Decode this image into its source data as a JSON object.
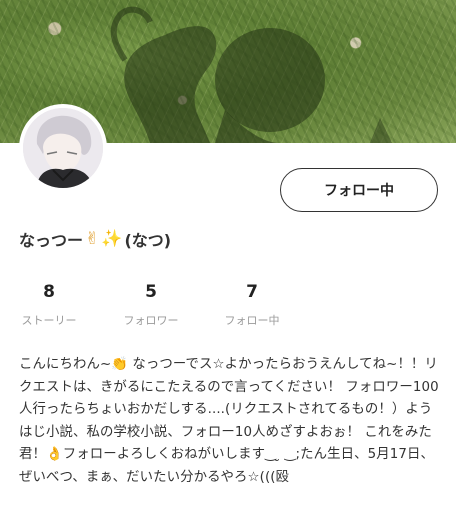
{
  "profile": {
    "name": "なっつー",
    "name_suffix": "(なつ)",
    "name_emoji_1": "✌",
    "name_emoji_2": "✨",
    "follow_button_label": "フォロー中"
  },
  "stats": [
    {
      "value": "8",
      "label": "ストーリー"
    },
    {
      "value": "5",
      "label": "フォロワー"
    },
    {
      "value": "7",
      "label": "フォロー中"
    }
  ],
  "bio": "こんにちわん~👏 なっつーでス☆よかったらおうえんしてね~！！リクエストは、きがるにこたえるので言ってください！ フォロワー100人行ったらちょいおかだしする....(リクエストされてるもの！）ようはじ小説、私の学校小説、フォロー10人めざすよおぉ！ これをみた君！👌フォローよろしくおねがいします‿ ̮ ‿;たん生日、5月17日、 ぜいべつ、まぁ、だいたい分かるやろ☆(((殴",
  "icons": {
    "cover": "cover-photo",
    "avatar": "avatar-image"
  }
}
